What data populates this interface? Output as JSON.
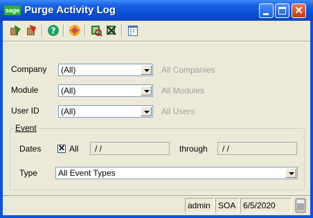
{
  "window": {
    "badge": "sage",
    "title": "Purge Activity Log"
  },
  "toolbar": {
    "buttons": [
      "accept-icon",
      "delete-icon",
      "help-icon",
      "wizard-icon",
      "lookup-icon",
      "clear-lookup-icon",
      "calendar-icon"
    ]
  },
  "form": {
    "company": {
      "label": "Company",
      "value": "(All)",
      "hint": "All Companies"
    },
    "module": {
      "label": "Module",
      "value": "(All)",
      "hint": "All Modules"
    },
    "user": {
      "label": "User ID",
      "value": "(All)",
      "hint": "All Users"
    }
  },
  "event": {
    "group_title": "Event",
    "dates_label": "Dates",
    "all_label": "All",
    "all_checked": true,
    "from_value": " / /",
    "through_label": "through",
    "to_value": " / /",
    "type_label": "Type",
    "type_value": "All Event Types"
  },
  "status": {
    "user": "admin",
    "company": "SOA",
    "date": "6/5/2020"
  },
  "colors": {
    "titlebar": "#0a4fd6",
    "face": "#ece9d8",
    "hint": "#a0a0a0"
  }
}
